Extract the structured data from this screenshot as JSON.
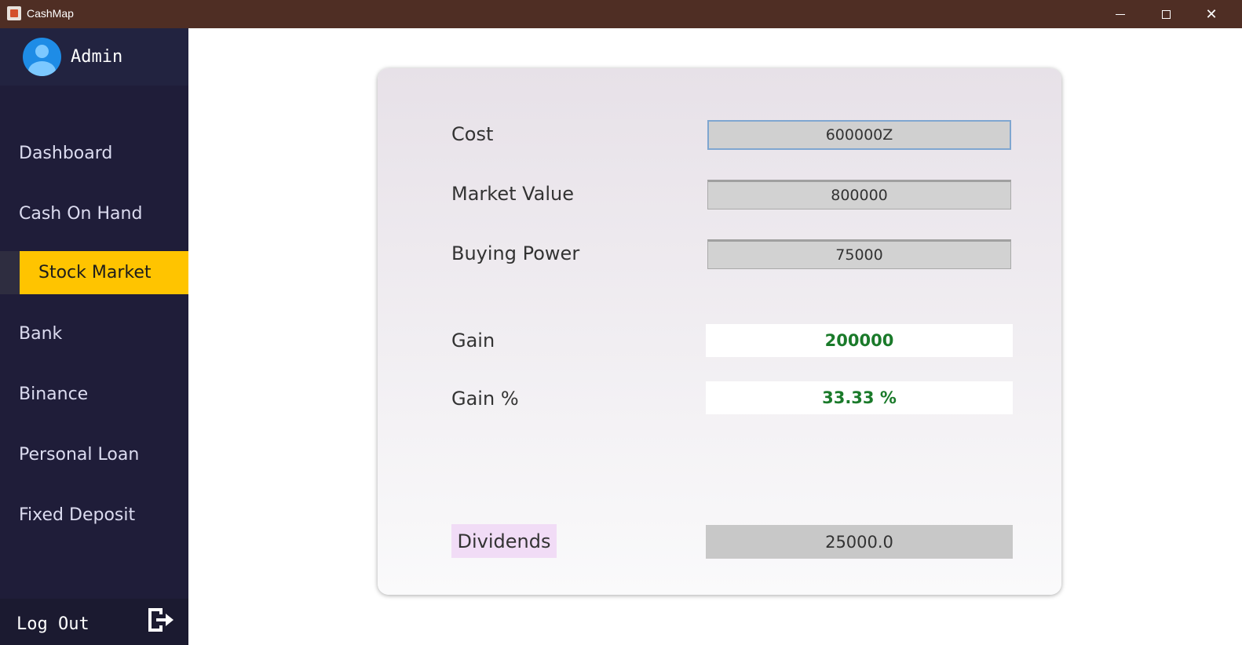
{
  "window": {
    "title": "CashMap"
  },
  "sidebar": {
    "user": "Admin",
    "items": [
      {
        "label": "Dashboard"
      },
      {
        "label": "Cash On Hand"
      },
      {
        "label": "Stock Market"
      },
      {
        "label": "Bank"
      },
      {
        "label": "Binance"
      },
      {
        "label": "Personal Loan"
      },
      {
        "label": "Fixed Deposit"
      }
    ],
    "active_item": "Stock Market",
    "logout_label": "Log Out"
  },
  "form": {
    "cost_label": "Cost",
    "cost_value": "600000Z",
    "market_value_label": "Market Value",
    "market_value_value": "800000",
    "buying_power_label": "Buying Power",
    "buying_power_value": "75000",
    "gain_label": "Gain",
    "gain_value": "200000",
    "gain_pct_label": "Gain %",
    "gain_pct_value": "33.33 %",
    "dividends_label": "Dividends",
    "dividends_value": "25000.0"
  },
  "colors": {
    "titlebar": "#4f2e24",
    "sidebar": "#1f1d39",
    "active_nav": "#ffc400",
    "gain_text": "#1a7a2a",
    "dividends_label_bg": "#f1dcf6"
  },
  "icons": {
    "app": "java-cup-icon",
    "avatar": "user-avatar-icon",
    "logout": "logout-arrow-icon"
  }
}
